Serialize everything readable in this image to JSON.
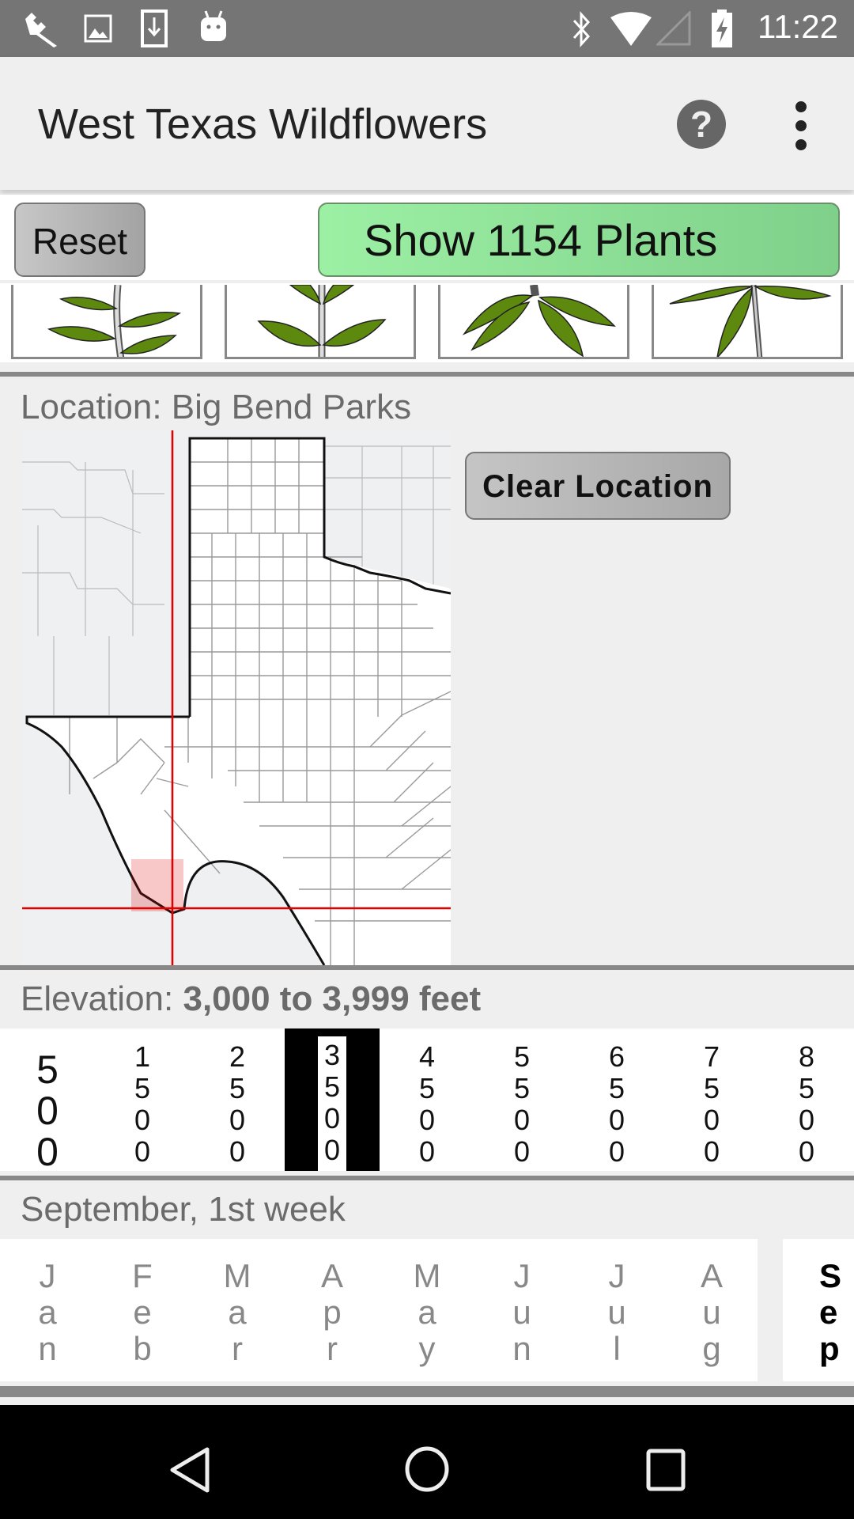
{
  "status_bar": {
    "time": "11:22",
    "left_icons": [
      "wrench-icon",
      "image-icon",
      "download-icon",
      "android-icon"
    ],
    "right_icons": [
      "bluetooth-icon",
      "wifi-icon",
      "signal-icon",
      "battery-charging-icon"
    ]
  },
  "app_bar": {
    "title": "West Texas Wildflowers",
    "help_label": "?",
    "overflow_icon": "more-vert-icon"
  },
  "toolbar": {
    "reset_label": "Reset",
    "show_label": "Show 1154 Plants",
    "show_color": "#8fe39a"
  },
  "leaf_shapes": [
    {
      "name": "alternate-leaves"
    },
    {
      "name": "opposite-leaves"
    },
    {
      "name": "whorled-leaves"
    },
    {
      "name": "basal-leaves"
    }
  ],
  "location": {
    "label": "Location: Big Bend Parks",
    "clear_label": "Clear Location",
    "map_marker_color": "#e00000"
  },
  "elevation": {
    "label_prefix": "Elevation: ",
    "label_value": "3,000 to 3,999 feet",
    "options": [
      "500",
      "1500",
      "2500",
      "3500",
      "4500",
      "5500",
      "6500",
      "7500",
      "8500"
    ],
    "selected_index": 3
  },
  "date": {
    "label": "September, 1st week",
    "months": [
      "Jan",
      "Feb",
      "Mar",
      "Apr",
      "May",
      "Jun",
      "Jul",
      "Aug",
      "Sep"
    ],
    "selected_index": 8
  },
  "nav_bar": {
    "icons": [
      "back-icon",
      "home-icon",
      "recents-icon"
    ]
  }
}
